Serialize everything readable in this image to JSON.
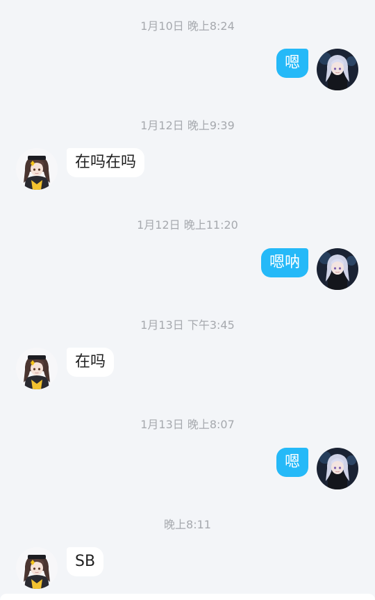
{
  "colors": {
    "background": "#f3f5f8",
    "my_bubble": "#25b9f8",
    "their_bubble": "#ffffff",
    "timestamp_text": "#a6a9ae"
  },
  "messages": [
    {
      "timestamp": "1月10日 晚上8:24",
      "sender": "me",
      "text": "嗯",
      "avatar": "anime-avatar-silver-hair"
    },
    {
      "timestamp": "1月12日 晚上9:39",
      "sender": "them",
      "text": "在吗在吗",
      "avatar": "anime-avatar-brown-hair"
    },
    {
      "timestamp": "1月12日 晚上11:20",
      "sender": "me",
      "text": "嗯呐",
      "avatar": "anime-avatar-silver-hair"
    },
    {
      "timestamp": "1月13日 下午3:45",
      "sender": "them",
      "text": "在吗",
      "avatar": "anime-avatar-brown-hair"
    },
    {
      "timestamp": "1月13日 晚上8:07",
      "sender": "me",
      "text": "嗯",
      "avatar": "anime-avatar-silver-hair"
    },
    {
      "timestamp": "晚上8:11",
      "sender": "them",
      "text": "SB",
      "avatar": "anime-avatar-brown-hair"
    }
  ]
}
